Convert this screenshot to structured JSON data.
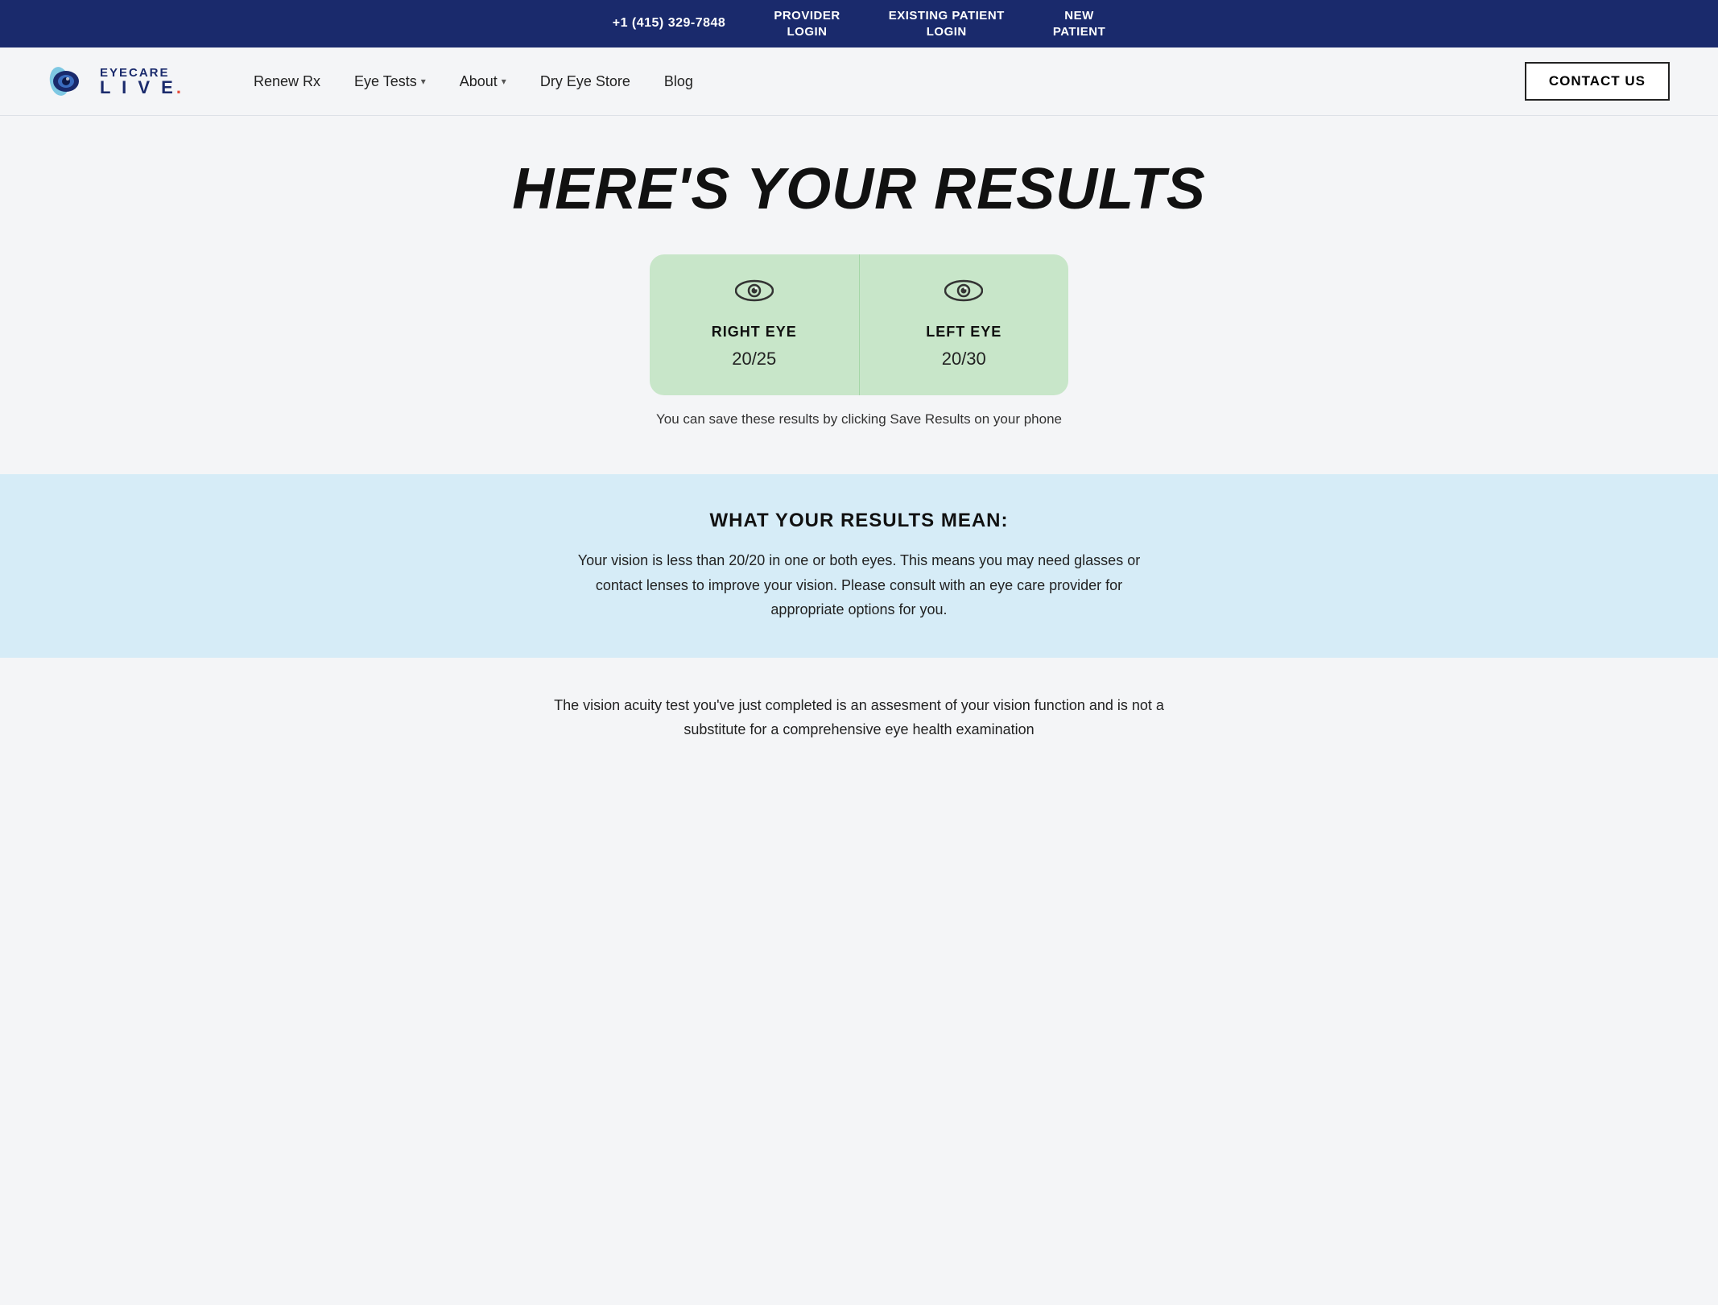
{
  "topbar": {
    "phone": "+1 (415) 329-7848",
    "provider_login": "PROVIDER\nLOGIN",
    "existing_patient_login": "EXISTING PATIENT\nLOGIN",
    "new_patient": "NEW\nPATIENT"
  },
  "header": {
    "logo": {
      "eyecare": "EYECARE",
      "live": "LIVE.",
      "alt": "Eyecare Live"
    },
    "nav": {
      "renew_rx": "Renew Rx",
      "eye_tests": "Eye Tests",
      "about": "About",
      "dry_eye_store": "Dry Eye Store",
      "blog": "Blog",
      "contact_us": "CONTACT US"
    }
  },
  "main": {
    "title": "HERE'S YOUR RESULTS",
    "right_eye": {
      "label": "RIGHT EYE",
      "value": "20/25"
    },
    "left_eye": {
      "label": "LEFT EYE",
      "value": "20/30"
    },
    "save_text": "You can save these results by clicking Save Results on your phone"
  },
  "blue_section": {
    "title": "WHAT YOUR RESULTS MEAN:",
    "text": "Your vision is less than 20/20 in one or both eyes. This means you may need glasses or contact lenses to improve your vision. Please consult with an eye care provider for appropriate options for you."
  },
  "bottom_section": {
    "text": "The vision acuity test you've just completed is an assesment of your vision function and is not a substitute for a comprehensive eye health examination"
  }
}
